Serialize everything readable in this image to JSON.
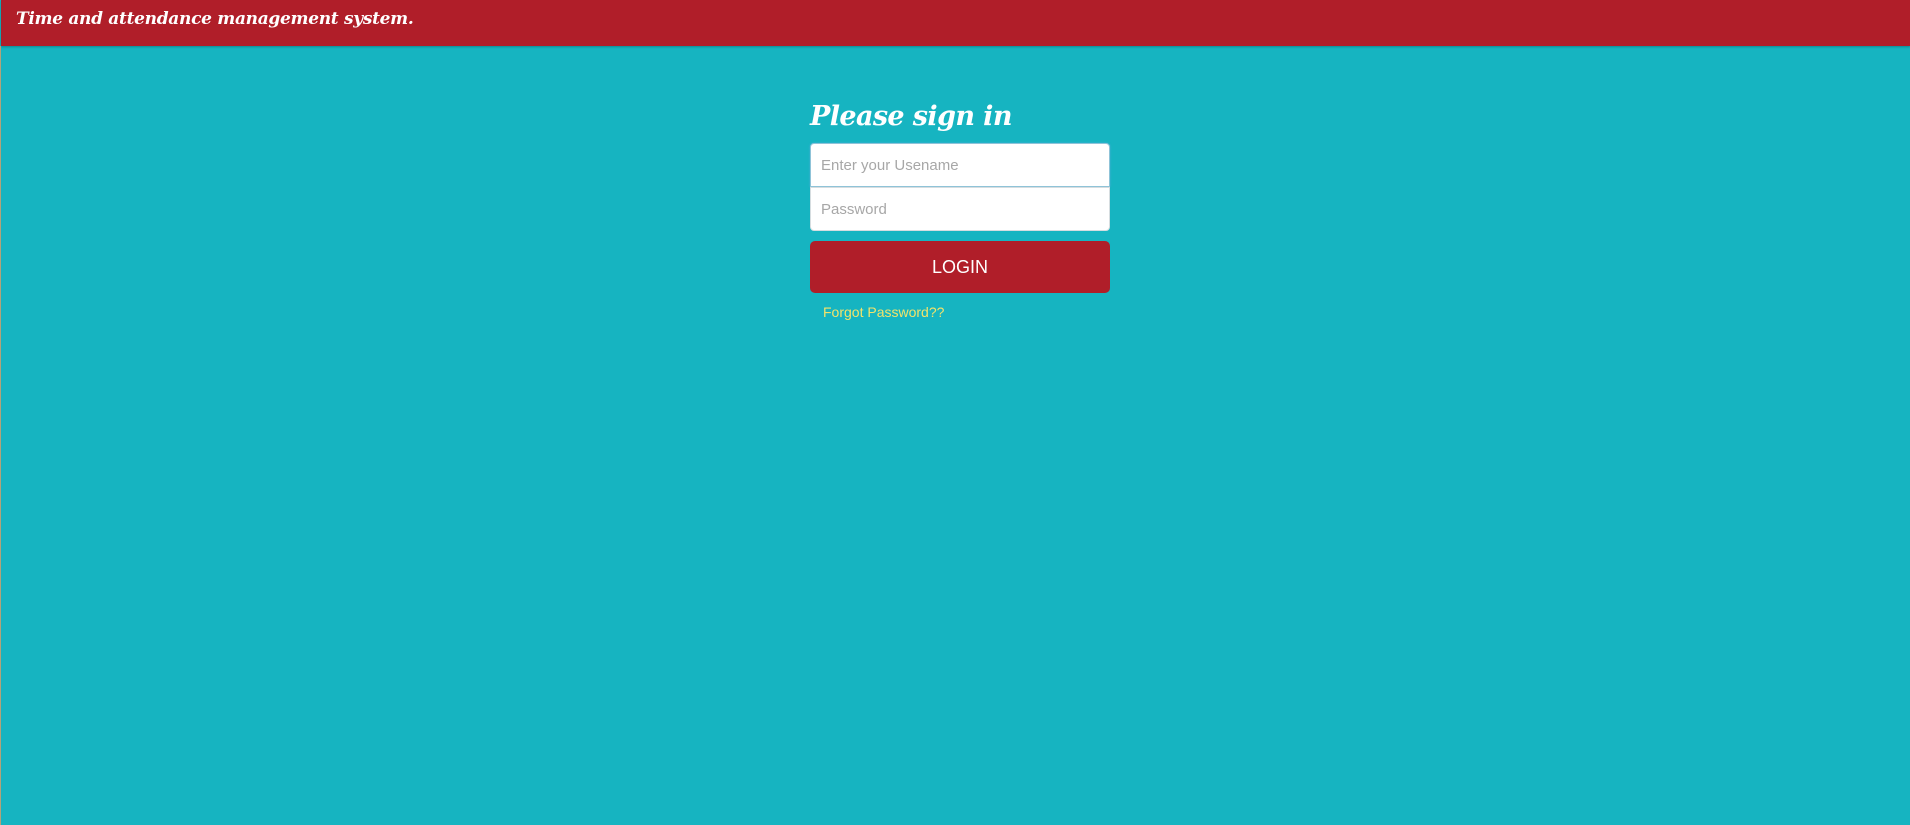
{
  "header": {
    "title": "Time and attendance management system."
  },
  "signin": {
    "heading": "Please sign in",
    "username_placeholder": "Enter your Usename",
    "username_value": "",
    "password_placeholder": "Password",
    "password_value": "",
    "login_label": "LOGIN",
    "forgot_label": "Forgot Password??"
  },
  "colors": {
    "background": "#16b4c1",
    "header": "#b01e29",
    "button": "#b01e29",
    "link": "#f3e36a"
  }
}
